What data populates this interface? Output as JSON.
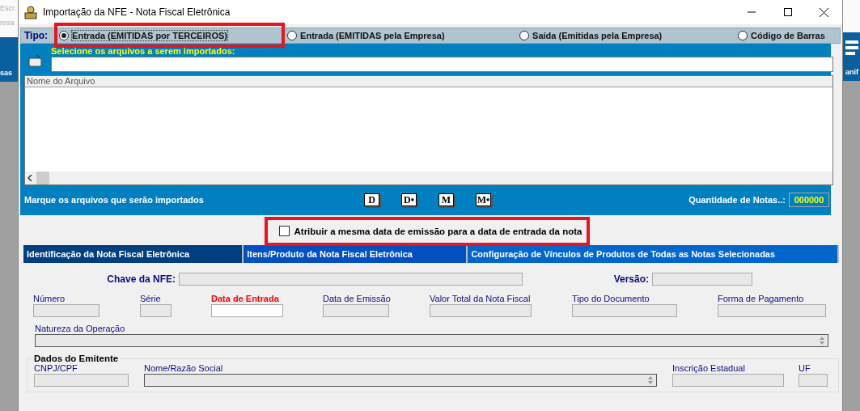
{
  "background": {
    "left_texts": [
      "Escr.",
      "resa",
      "sas"
    ],
    "right_text": "anif"
  },
  "window": {
    "title": "Importação da NFE - Nota Fiscal Eletrônica"
  },
  "tipo": {
    "label": "Tipo:",
    "options": [
      {
        "label": "Entrada (EMITIDAS por TERCEIROS)",
        "selected": true,
        "highlighted": true
      },
      {
        "label": "Entrada (EMITIDAS pela Empresa)",
        "selected": false,
        "highlighted": false
      },
      {
        "label": "Saída (Emitidas pela Empresa)",
        "selected": false,
        "highlighted": false
      },
      {
        "label": "Código de Barras",
        "selected": false,
        "highlighted": false
      }
    ]
  },
  "files": {
    "prompt": "Selecione os arquivos a serem importados:",
    "column": "Nome do Arquivo",
    "hint": "Marque os arquivos que serão importados",
    "buttons": [
      "D",
      "D•",
      "M",
      "M•"
    ],
    "count_label": "Quantidade de Notas..:",
    "count": "000000"
  },
  "same_date": {
    "label": "Atribuir a mesma data de emissão para a data de entrada da nota",
    "checked": false,
    "highlighted": true
  },
  "tabs": [
    {
      "label": "Identificação da Nota Fiscal Eletrônica",
      "selected": true
    },
    {
      "label": "Itens/Produto da Nota Fiscal Eletrônica",
      "selected": false
    },
    {
      "label": "Configuração de Vínculos de Produtos de Todas as Notas Selecionadas",
      "selected": false
    }
  ],
  "nfe": {
    "chave_label": "Chave da NFE:",
    "versao_label": "Versão:",
    "fields": [
      {
        "label": "Número",
        "kind": "readonly"
      },
      {
        "label": "Série",
        "kind": "readonly"
      },
      {
        "label": "Data de Entrada",
        "kind": "required"
      },
      {
        "label": "Data de Emissão",
        "kind": "readonly"
      },
      {
        "label": "Valor Total da Nota Fiscal",
        "kind": "readonly"
      },
      {
        "label": "Tipo do Documento",
        "kind": "readonly"
      },
      {
        "label": "Forma de Pagamento",
        "kind": "readonly"
      }
    ],
    "natureza_label": "Natureza da Operação"
  },
  "emitente": {
    "title": "Dados do Emitente",
    "fields": [
      {
        "label": "CNPJ/CPF",
        "kind": "readonly"
      },
      {
        "label": "Nome/Razão Social",
        "kind": "memo"
      },
      {
        "label": "Inscrição Estadual",
        "kind": "readonly"
      },
      {
        "label": "UF",
        "kind": "readonly"
      }
    ]
  }
}
